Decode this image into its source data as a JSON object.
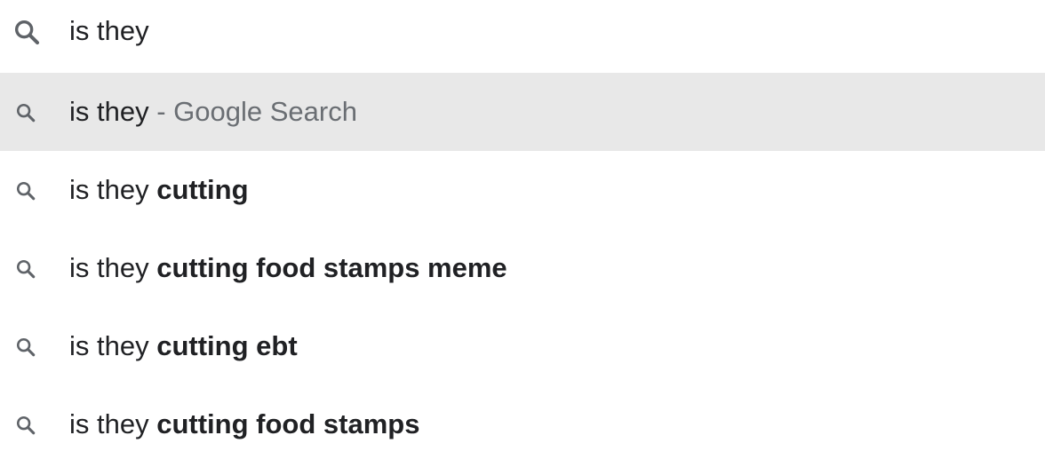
{
  "search": {
    "value": "is they",
    "icon": "search-icon"
  },
  "suggestions": [
    {
      "query": "is they",
      "completion": "",
      "source": " - Google Search",
      "selected": true,
      "icon": "search-icon"
    },
    {
      "query": "is they ",
      "completion": "cutting",
      "source": "",
      "selected": false,
      "icon": "search-icon"
    },
    {
      "query": "is they ",
      "completion": "cutting food stamps meme",
      "source": "",
      "selected": false,
      "icon": "search-icon"
    },
    {
      "query": "is they ",
      "completion": "cutting ebt",
      "source": "",
      "selected": false,
      "icon": "search-icon"
    },
    {
      "query": "is they ",
      "completion": "cutting food stamps",
      "source": "",
      "selected": false,
      "icon": "search-icon"
    }
  ],
  "colors": {
    "selected_row": "#e8e8e8",
    "icon": "#5f6368",
    "muted_text": "#6a6e73"
  }
}
